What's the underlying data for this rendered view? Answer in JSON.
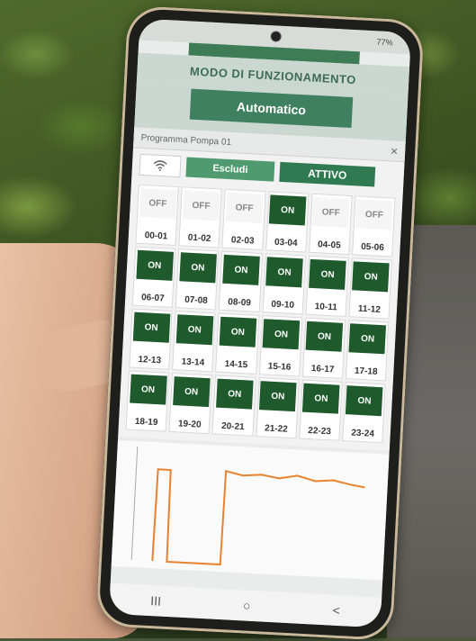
{
  "status_bar": {
    "battery": "77%"
  },
  "mode": {
    "title": "MODO DI FUNZIONAMENTO",
    "button_label": "Automatico"
  },
  "dialog": {
    "title": "Programma Pompa 01",
    "close": "×",
    "escludi": "Escludi",
    "attivo": "ATTIVO"
  },
  "schedule": [
    {
      "state": "OFF",
      "slot": "00-01"
    },
    {
      "state": "OFF",
      "slot": "01-02"
    },
    {
      "state": "OFF",
      "slot": "02-03"
    },
    {
      "state": "ON",
      "slot": "03-04"
    },
    {
      "state": "OFF",
      "slot": "04-05"
    },
    {
      "state": "OFF",
      "slot": "05-06"
    },
    {
      "state": "ON",
      "slot": "06-07"
    },
    {
      "state": "ON",
      "slot": "07-08"
    },
    {
      "state": "ON",
      "slot": "08-09"
    },
    {
      "state": "ON",
      "slot": "09-10"
    },
    {
      "state": "ON",
      "slot": "10-11"
    },
    {
      "state": "ON",
      "slot": "11-12"
    },
    {
      "state": "ON",
      "slot": "12-13"
    },
    {
      "state": "ON",
      "slot": "13-14"
    },
    {
      "state": "ON",
      "slot": "14-15"
    },
    {
      "state": "ON",
      "slot": "15-16"
    },
    {
      "state": "ON",
      "slot": "16-17"
    },
    {
      "state": "ON",
      "slot": "17-18"
    },
    {
      "state": "ON",
      "slot": "18-19"
    },
    {
      "state": "ON",
      "slot": "19-20"
    },
    {
      "state": "ON",
      "slot": "20-21"
    },
    {
      "state": "ON",
      "slot": "21-22"
    },
    {
      "state": "ON",
      "slot": "22-23"
    },
    {
      "state": "ON",
      "slot": "23-24"
    }
  ],
  "nav": {
    "recent": "III",
    "home": "○",
    "back": "<"
  },
  "colors": {
    "on": "#1f5a2c",
    "accent": "#3f8060",
    "chart_line": "#e8822e"
  }
}
